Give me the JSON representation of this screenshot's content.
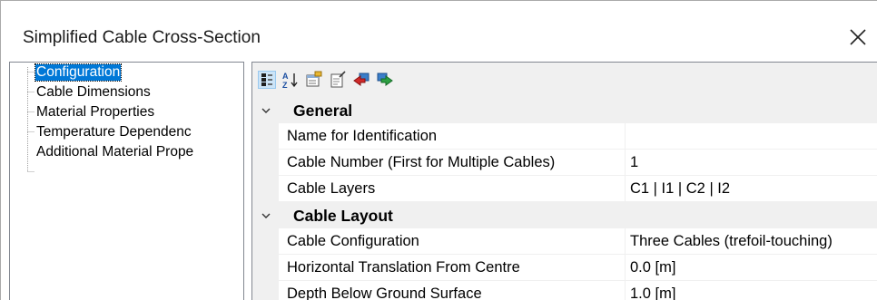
{
  "window": {
    "title": "Simplified Cable Cross-Section",
    "close_icon": "close-icon"
  },
  "tree": {
    "items": [
      {
        "label": "Configuration",
        "selected": true
      },
      {
        "label": "Cable Dimensions",
        "selected": false
      },
      {
        "label": "Material Properties",
        "selected": false
      },
      {
        "label": "Temperature Dependenc",
        "selected": false
      },
      {
        "label": "Additional Material Prope",
        "selected": false
      }
    ]
  },
  "toolbar": {
    "buttons": [
      {
        "icon": "categorized-icon",
        "active": true
      },
      {
        "icon": "alphabetical-sort-icon",
        "active": false
      },
      {
        "icon": "property-pages-icon",
        "active": false
      },
      {
        "icon": "edit-document-icon",
        "active": false
      },
      {
        "icon": "red-arrow-back-icon",
        "active": false
      },
      {
        "icon": "green-arrow-forward-icon",
        "active": false
      }
    ]
  },
  "grid": {
    "categories": [
      {
        "label": "General",
        "properties": [
          {
            "name": "Name for Identification",
            "value": ""
          },
          {
            "name": "Cable Number (First for Multiple Cables)",
            "value": "1"
          },
          {
            "name": "Cable Layers",
            "value": "C1 | I1 | C2 | I2"
          }
        ]
      },
      {
        "label": "Cable Layout",
        "properties": [
          {
            "name": "Cable Configuration",
            "value": "Three Cables (trefoil-touching)"
          },
          {
            "name": "Horizontal Translation From Centre",
            "value": "0.0 [m]"
          },
          {
            "name": "Depth Below Ground Surface",
            "value": "1.0 [m]"
          }
        ]
      }
    ]
  }
}
